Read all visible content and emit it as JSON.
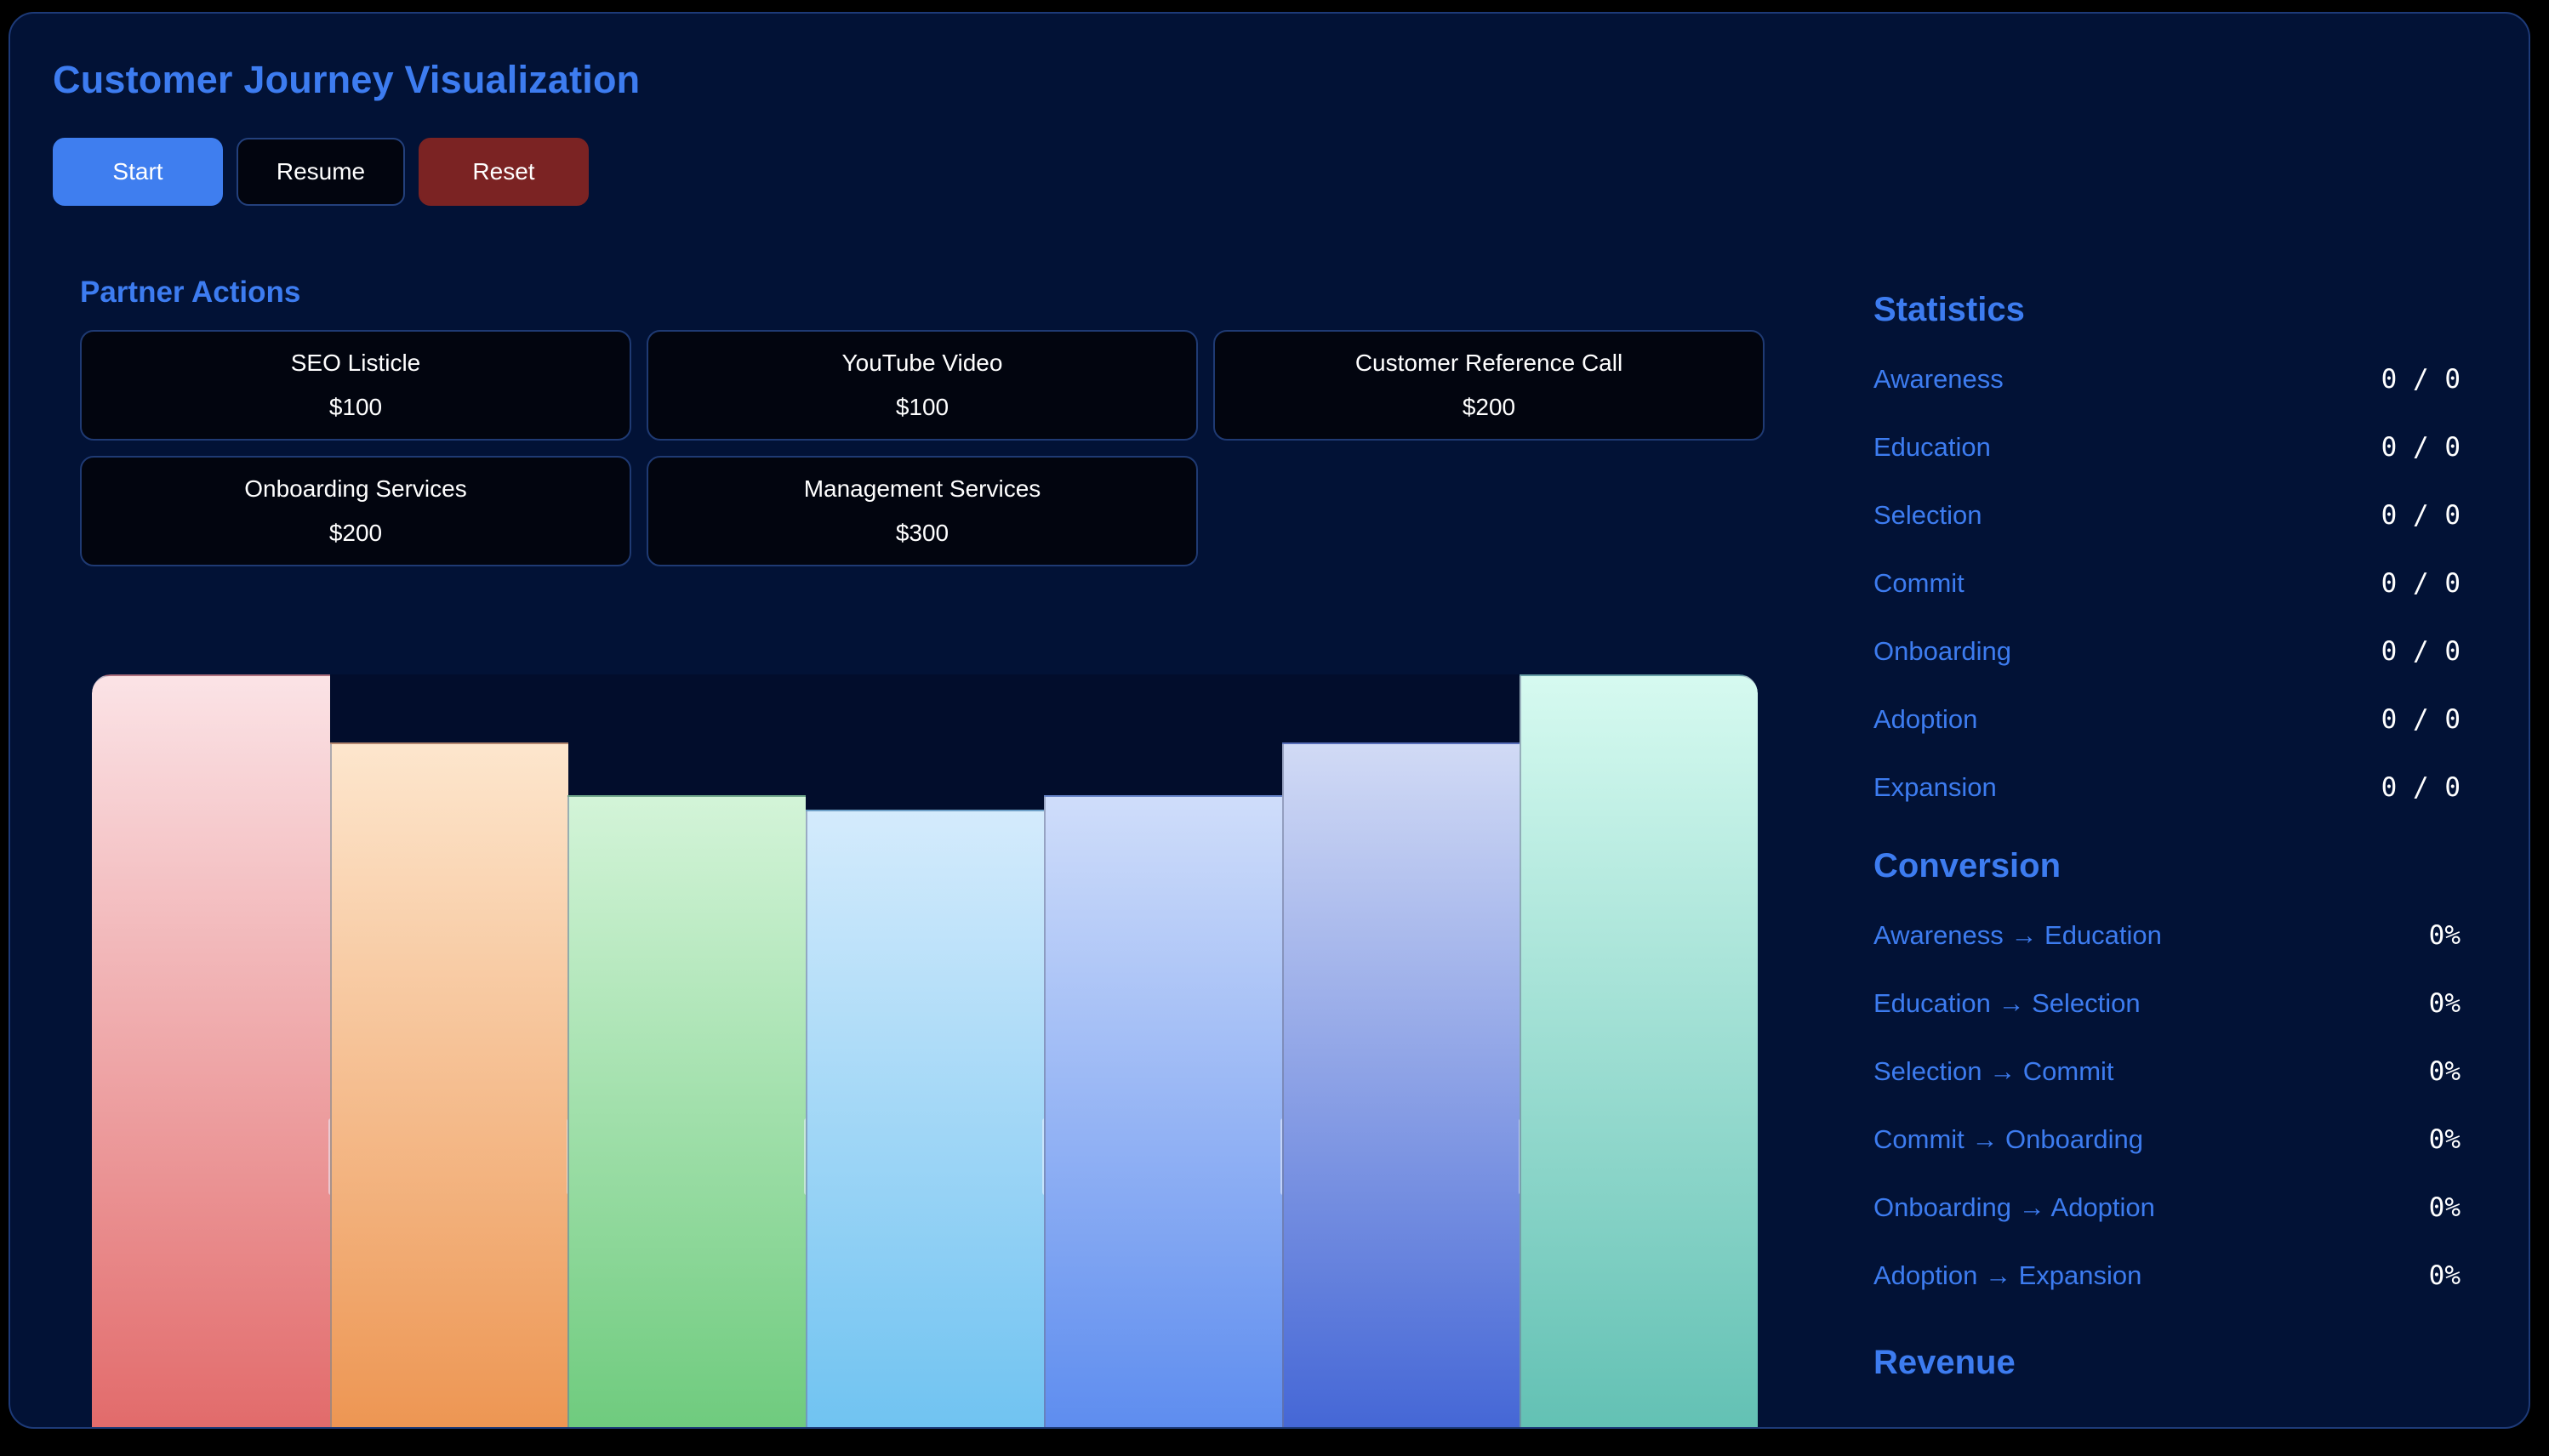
{
  "app": {
    "title": "Customer Journey Visualization"
  },
  "controls": {
    "start_label": "Start",
    "resume_label": "Resume",
    "reset_label": "Reset"
  },
  "partner_actions": {
    "heading": "Partner Actions",
    "items": [
      {
        "label": "SEO Listicle",
        "price": "$100"
      },
      {
        "label": "YouTube Video",
        "price": "$100"
      },
      {
        "label": "Customer Reference Call",
        "price": "$200"
      },
      {
        "label": "Onboarding Services",
        "price": "$200"
      },
      {
        "label": "Management Services",
        "price": "$300"
      }
    ]
  },
  "funnel": {
    "stages": [
      {
        "name": "Awareness",
        "level": 1.0,
        "color_top": "#fbe3e6",
        "color_bottom": "#e26b6b"
      },
      {
        "name": "Education",
        "level": 0.91,
        "color_top": "#fde6cd",
        "color_bottom": "#ed9653"
      },
      {
        "name": "Selection",
        "level": 0.84,
        "color_top": "#d3f4d8",
        "color_bottom": "#6fcb7e"
      },
      {
        "name": "Commit",
        "level": 0.82,
        "color_top": "#d4ebfc",
        "color_bottom": "#70c3f1"
      },
      {
        "name": "Onboarding",
        "level": 0.84,
        "color_top": "#cfddfa",
        "color_bottom": "#5e8def"
      },
      {
        "name": "Adoption",
        "level": 0.91,
        "color_top": "#d1daf5",
        "color_bottom": "#4567d6"
      },
      {
        "name": "Expansion",
        "level": 1.0,
        "color_top": "#d6faf0",
        "color_bottom": "#63c1b4"
      }
    ]
  },
  "statistics": {
    "heading": "Statistics",
    "rows": [
      {
        "label": "Awareness",
        "value": "0 / 0"
      },
      {
        "label": "Education",
        "value": "0 / 0"
      },
      {
        "label": "Selection",
        "value": "0 / 0"
      },
      {
        "label": "Commit",
        "value": "0 / 0"
      },
      {
        "label": "Onboarding",
        "value": "0 / 0"
      },
      {
        "label": "Adoption",
        "value": "0 / 0"
      },
      {
        "label": "Expansion",
        "value": "0 / 0"
      }
    ]
  },
  "conversion": {
    "heading": "Conversion",
    "rows": [
      {
        "label": "Awareness → Education",
        "value": "0%"
      },
      {
        "label": "Education → Selection",
        "value": "0%"
      },
      {
        "label": "Selection → Commit",
        "value": "0%"
      },
      {
        "label": "Commit → Onboarding",
        "value": "0%"
      },
      {
        "label": "Onboarding → Adoption",
        "value": "0%"
      },
      {
        "label": "Adoption → Expansion",
        "value": "0%"
      }
    ]
  },
  "revenue": {
    "heading": "Revenue"
  },
  "colors": {
    "accent": "#3d7cf0",
    "background": "#021236",
    "start_button": "#3f7eef",
    "reset_button": "#7b2323"
  }
}
